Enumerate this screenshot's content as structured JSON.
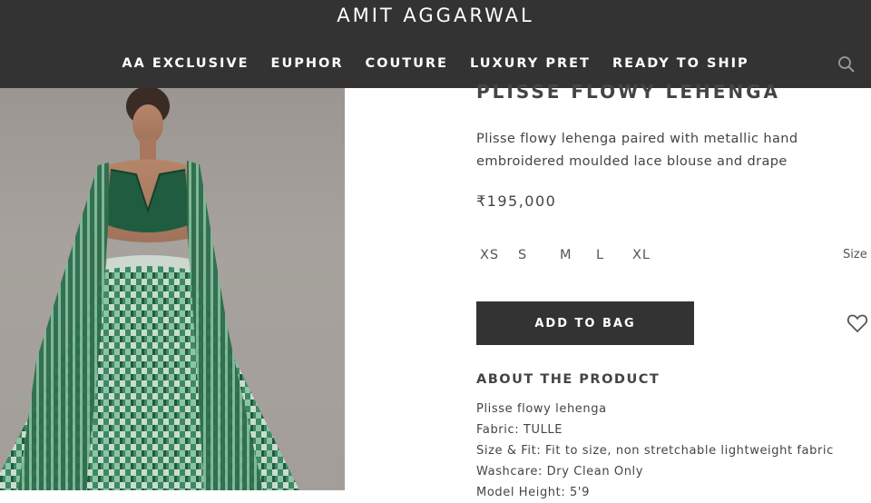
{
  "header": {
    "brand": "AMIT AGGARWAL",
    "nav": [
      "AA EXCLUSIVE",
      "EUPHOR",
      "COUTURE",
      "LUXURY PRET",
      "READY TO SHIP"
    ],
    "search_icon": "search-icon"
  },
  "product": {
    "title": "PLISSE FLOWY LEHENGA",
    "description": "Plisse flowy lehenga paired with metallic hand embroidered moulded lace blouse and drape",
    "price": "₹195,000",
    "sizes": [
      "XS",
      "S",
      "M",
      "L",
      "XL"
    ],
    "size_chart_label": "Size",
    "add_to_bag_label": "ADD TO BAG",
    "wishlist_icon": "heart-icon",
    "about_heading": "ABOUT THE PRODUCT",
    "about": [
      "Plisse flowy lehenga",
      "Fabric: TULLE",
      "Size & Fit: Fit to size, non stretchable lightweight fabric",
      "Washcare: Dry Clean Only",
      "Model Height: 5'9"
    ]
  },
  "colors": {
    "header_bg": "#333333",
    "button_bg": "#333333",
    "lehenga_green": "#2f7a56"
  }
}
